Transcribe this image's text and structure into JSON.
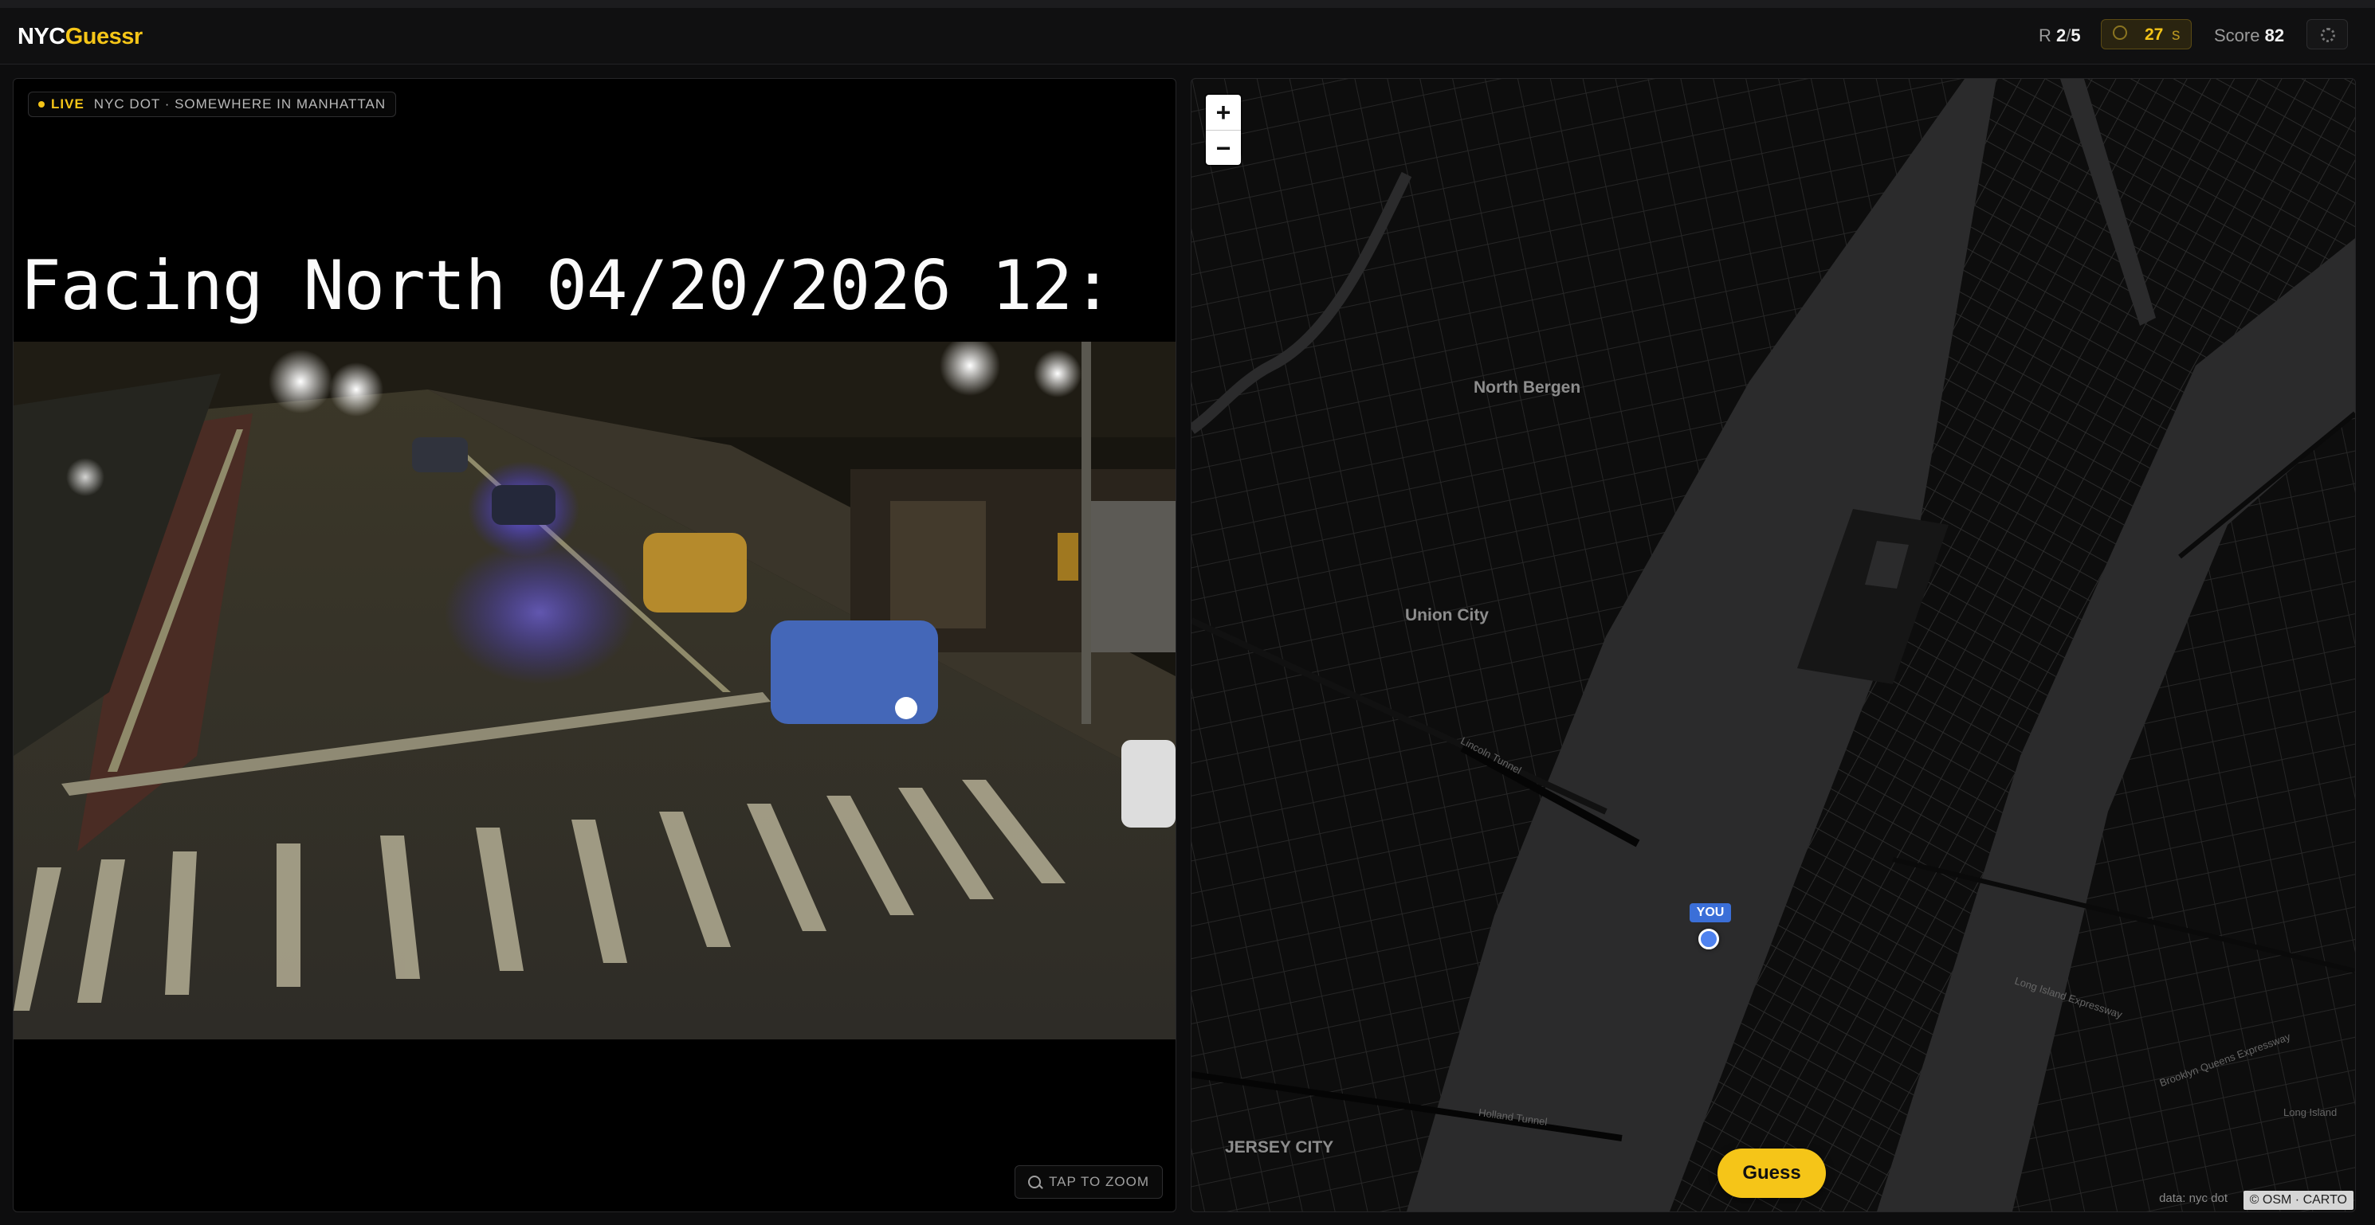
{
  "app": {
    "logo_part1": "NYC",
    "logo_part2": "Guessr"
  },
  "header": {
    "round_prefix": "R",
    "round_current": "2",
    "round_sep": "/",
    "round_total": "5",
    "timer_value": "27",
    "timer_unit": "s",
    "timer_icon": "clock-icon",
    "score_label": "Score",
    "score_value": "82",
    "settings_icon": "settings-icon"
  },
  "camera": {
    "live_label": "LIVE",
    "source_text": "NYC DOT · SOMEWHERE IN MANHATTAN",
    "overlay_text": "Facing North 04/20/2026 12:",
    "zoom_hint": "TAP TO ZOOM",
    "zoom_icon": "magnifier-icon"
  },
  "map": {
    "zoom_in": "+",
    "zoom_out": "−",
    "places": {
      "north_bergen": "North Bergen",
      "union_city": "Union City",
      "jersey_city": "JERSEY CITY"
    },
    "streets": {
      "lincoln_tunnel": "Lincoln Tunnel",
      "holland_tunnel": "Holland Tunnel",
      "long_island_expressway": "Long Island Expressway",
      "brooklyn_queens_expressway": "Brooklyn Queens Expressway",
      "long_island": "Long Island"
    },
    "you_label": "YOU",
    "guess_label": "Guess",
    "data_source": "data: nyc dot",
    "credit": "© OSM · CARTO"
  }
}
